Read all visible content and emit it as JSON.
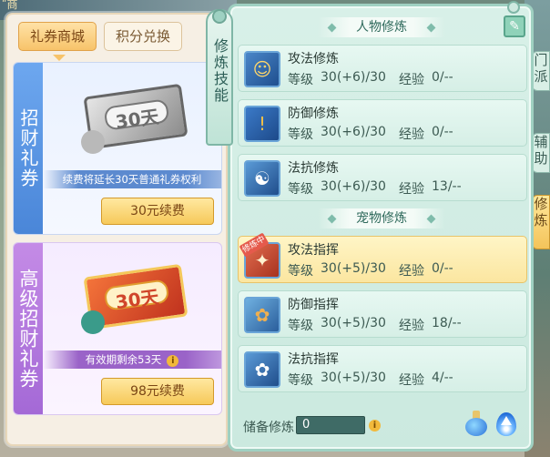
{
  "scene": {
    "top_left_text": "ʺ商",
    "side_buttons": [
      "门派",
      "辅助",
      "修炼"
    ]
  },
  "left_panel": {
    "tabs": [
      {
        "label": "礼券商城",
        "active": true
      },
      {
        "label": "积分兑换",
        "active": false
      }
    ],
    "cards": [
      {
        "title": "招财礼券",
        "ticket_text": "30天",
        "note": "续费将延长30天普通礼券权利",
        "button": "30元续费"
      },
      {
        "title": "高级招财礼券",
        "ticket_text": "30天",
        "note": "有效期剩余53天",
        "button": "98元续费"
      }
    ]
  },
  "skill_tab": {
    "label": "修炼技能"
  },
  "panel": {
    "sections": [
      {
        "title": "人物修炼"
      },
      {
        "title": "宠物修炼"
      }
    ],
    "rows": [
      {
        "name": "攻法修炼",
        "level_label": "等级",
        "level": "30(+6)/30",
        "exp_label": "经验",
        "exp": "0/--",
        "icon": "person-attack-icon",
        "selected": false
      },
      {
        "name": "防御修炼",
        "level_label": "等级",
        "level": "30(+6)/30",
        "exp_label": "经验",
        "exp": "0/--",
        "icon": "shield-icon",
        "selected": false
      },
      {
        "name": "法抗修炼",
        "level_label": "等级",
        "level": "30(+6)/30",
        "exp_label": "经验",
        "exp": "13/--",
        "icon": "yin-yang-icon",
        "selected": false
      },
      {
        "name": "攻法指挥",
        "level_label": "等级",
        "level": "30(+5)/30",
        "exp_label": "经验",
        "exp": "0/--",
        "icon": "pet-attack-icon",
        "badge": "修炼中",
        "selected": true
      },
      {
        "name": "防御指挥",
        "level_label": "等级",
        "level": "30(+5)/30",
        "exp_label": "经验",
        "exp": "18/--",
        "icon": "paw-shield-icon",
        "selected": false
      },
      {
        "name": "法抗指挥",
        "level_label": "等级",
        "level": "30(+5)/30",
        "exp_label": "经验",
        "exp": "4/--",
        "icon": "paw-resist-icon",
        "selected": false
      }
    ],
    "reserve_label": "储备修炼",
    "reserve_value": "0"
  }
}
